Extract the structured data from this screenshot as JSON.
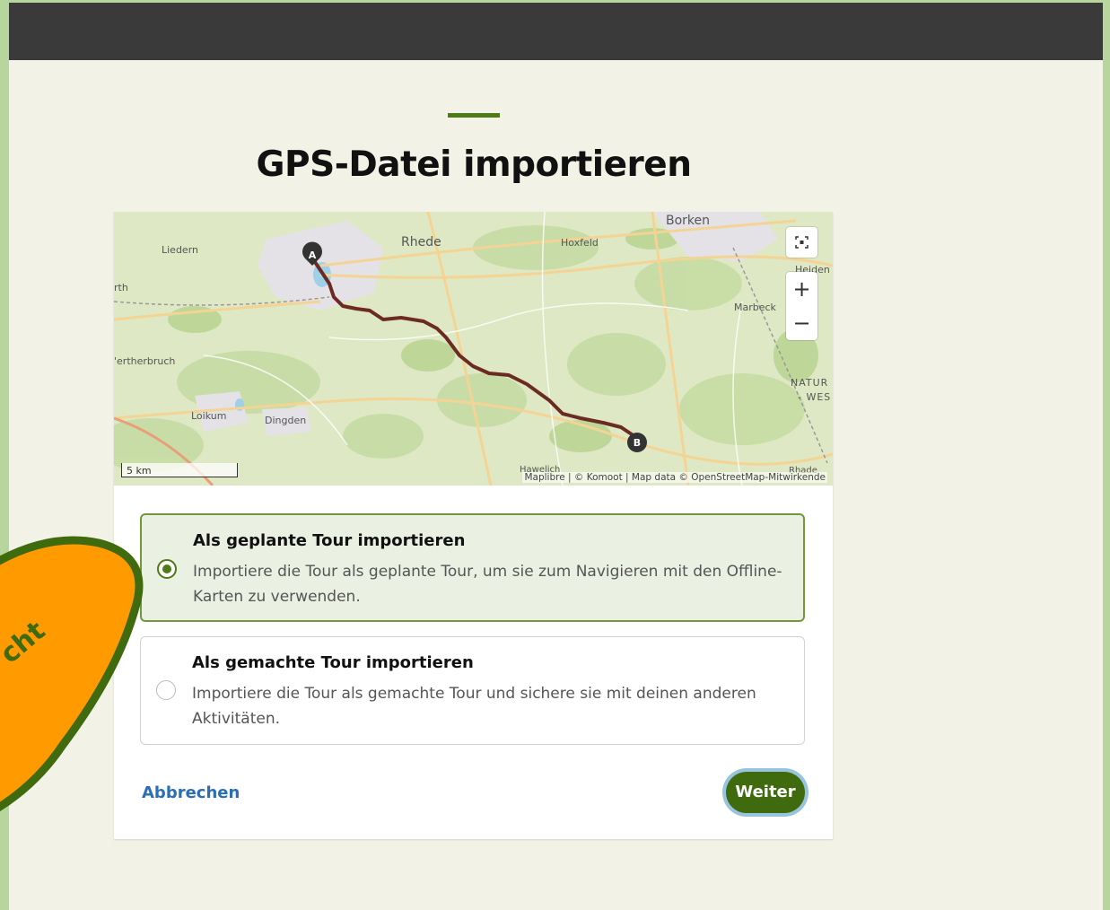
{
  "page": {
    "title": "GPS-Datei importieren"
  },
  "map": {
    "place_labels": {
      "borken": "Borken",
      "rhede": "Rhede",
      "liedern": "Liedern",
      "hoxfeld": "Hoxfeld",
      "heiden": "Heiden",
      "marbeck": "Marbeck",
      "rth": "rth",
      "werth": "'ertherbruch",
      "loikum": "Loikum",
      "dingden": "Dingden",
      "natur": "NATUR",
      "wes": "- WES",
      "hamelch": "Hawelich",
      "rhade": "Rhade"
    },
    "markers": {
      "start": "A",
      "end": "B"
    },
    "scale_label": "5 km",
    "attribution": "Maplibre | © Komoot | Map data © OpenStreetMap-Mitwirkende",
    "controls": {
      "fullscreen": "fullscreen-icon",
      "zoom_in": "+",
      "zoom_out": "−"
    },
    "route_color": "#6b2a22"
  },
  "options": [
    {
      "title": "Als geplante Tour importieren",
      "description": "Importiere die Tour als geplante Tour, um sie zum Navigieren mit den Offline-Karten zu verwenden.",
      "selected": true
    },
    {
      "title": "Als gemachte Tour importieren",
      "description": "Importiere die Tour als gemachte Tour und sichere sie mit deinen anderen Aktivitäten.",
      "selected": false
    }
  ],
  "actions": {
    "cancel_label": "Abbrechen",
    "next_label": "Weiter"
  },
  "sticker": {
    "partial_text": "cht",
    "color": "#ff9a00",
    "border_color": "#3f6a0e"
  },
  "colors": {
    "accent": "#4f7b17",
    "background": "#f2f2e6",
    "top_bar": "#3a3a3a",
    "link": "#2a6fb5"
  }
}
